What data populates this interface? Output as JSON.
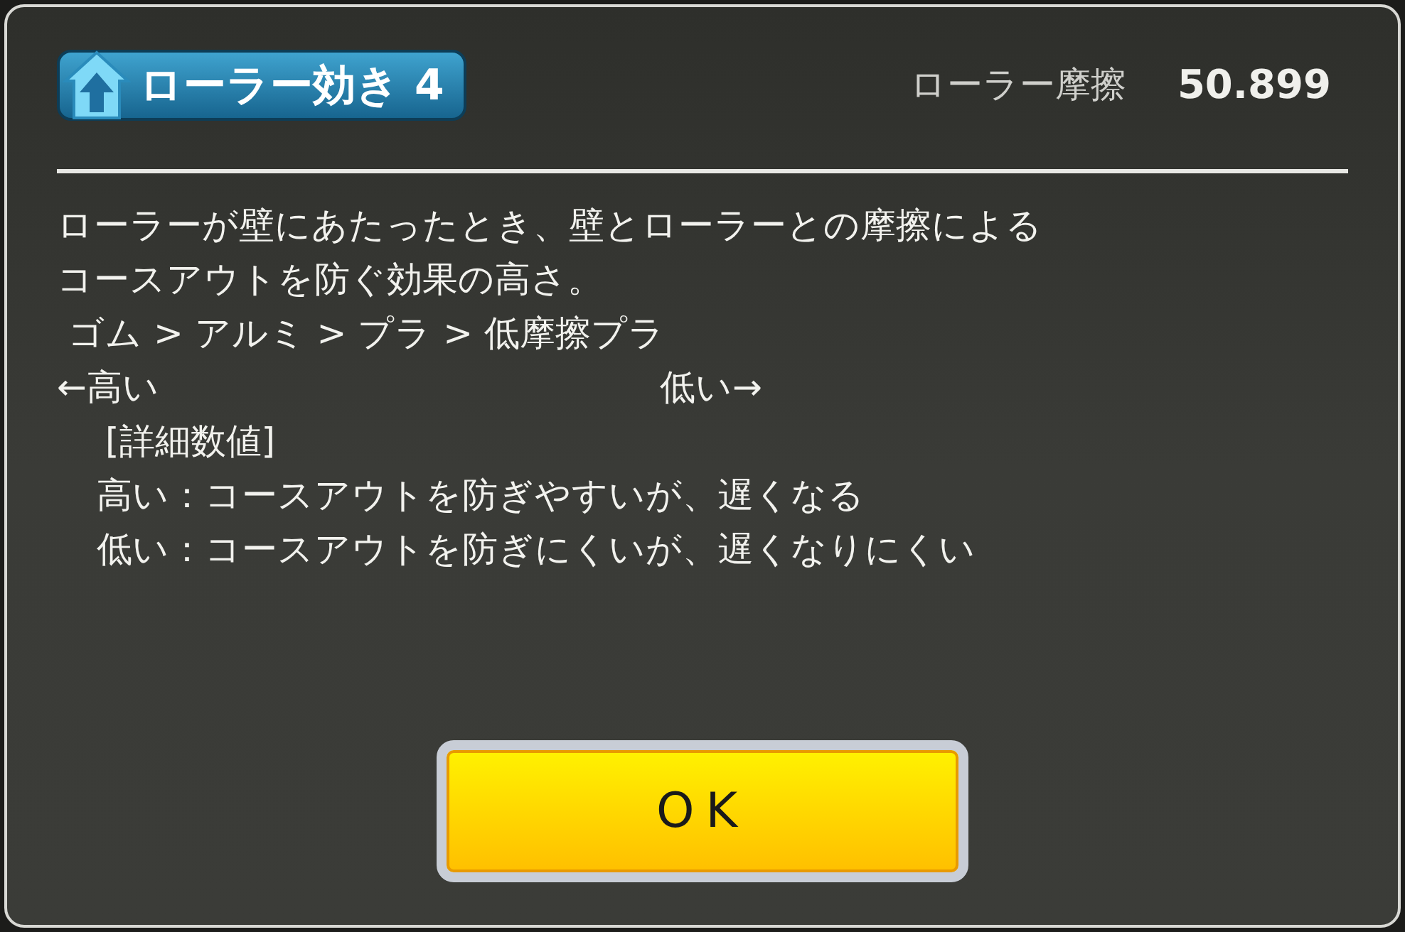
{
  "header": {
    "title": "ローラー効き 4",
    "stat_label": "ローラー摩擦",
    "stat_value": "50.899"
  },
  "description": [
    "ローラーが壁にあたったとき、壁とローラーとの摩擦による",
    "コースアウトを防ぐ効果の高さ。"
  ],
  "ranking": "ゴム > アルミ > プラ > 低摩擦プラ",
  "scale": {
    "high": "←高い",
    "low": "低い→"
  },
  "details": {
    "heading": "[詳細数値]",
    "lines": [
      "高い：コースアウトを防ぎやすいが、遅くなる",
      "低い：コースアウトを防ぎにくいが、遅くなりにくい"
    ]
  },
  "button": {
    "label": "OK"
  }
}
